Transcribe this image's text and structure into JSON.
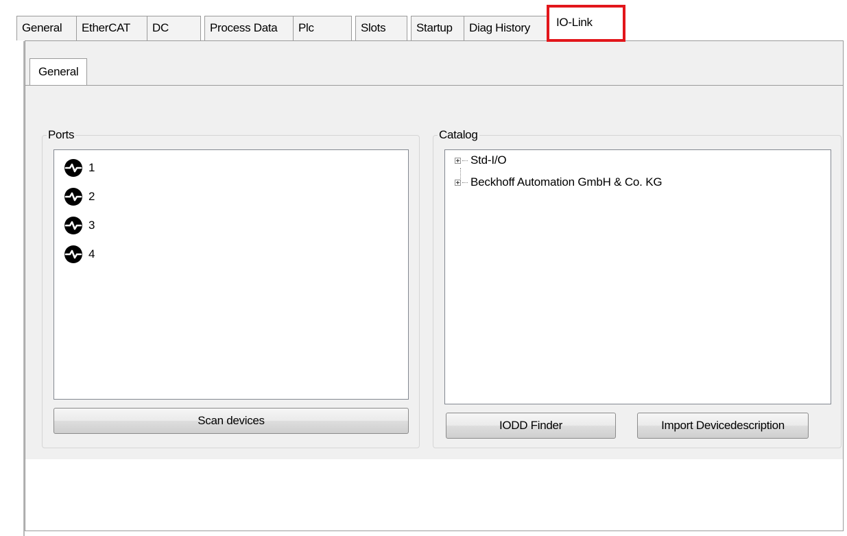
{
  "tabs": [
    {
      "label": "General"
    },
    {
      "label": "EtherCAT"
    },
    {
      "label": "DC"
    },
    {
      "label": "Process Data"
    },
    {
      "label": "Plc"
    },
    {
      "label": "Slots"
    },
    {
      "label": "Startup"
    },
    {
      "label": "Diag History"
    },
    {
      "label": "IO-Link",
      "active": true
    }
  ],
  "subtabs": [
    {
      "label": "General"
    }
  ],
  "ports_group": {
    "label": "Ports",
    "items": [
      {
        "label": "1",
        "icon": "io-link-port-icon"
      },
      {
        "label": "2",
        "icon": "io-link-port-icon"
      },
      {
        "label": "3",
        "icon": "io-link-port-icon"
      },
      {
        "label": "4",
        "icon": "io-link-port-icon"
      }
    ],
    "scan_button": "Scan devices"
  },
  "catalog_group": {
    "label": "Catalog",
    "tree": [
      {
        "label": "Std-I/O"
      },
      {
        "label": "Beckhoff Automation GmbH & Co. KG"
      }
    ],
    "iodd_button": "IODD Finder",
    "import_button": "Import Devicedescription"
  },
  "colors": {
    "highlight": "#e2161b"
  }
}
